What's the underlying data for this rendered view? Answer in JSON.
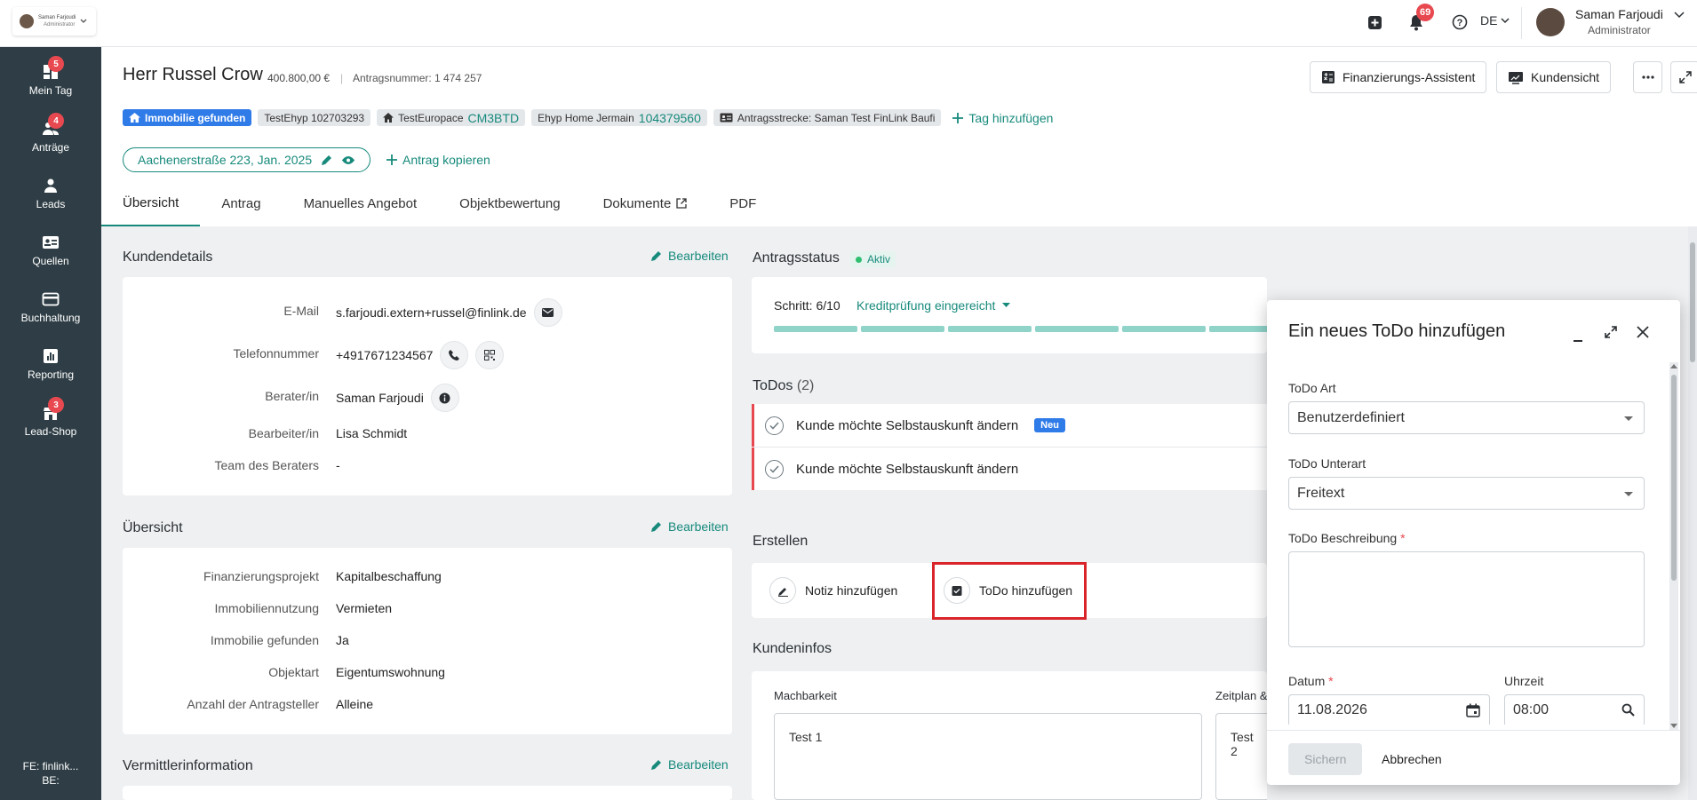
{
  "topbar": {
    "org_name": "Saman Farjoudi",
    "org_role": "Administrator",
    "notifications_count": "69",
    "language": "DE",
    "user_name": "Saman Farjoudi",
    "user_role": "Administrator"
  },
  "sidebar": {
    "items": [
      {
        "label": "Mein Tag",
        "badge": "5"
      },
      {
        "label": "Anträge",
        "badge": "4"
      },
      {
        "label": "Leads",
        "badge": ""
      },
      {
        "label": "Quellen",
        "badge": ""
      },
      {
        "label": "Buchhaltung",
        "badge": ""
      },
      {
        "label": "Reporting",
        "badge": ""
      },
      {
        "label": "Lead-Shop",
        "badge": "3"
      }
    ],
    "footer_fe": "FE: finlink...",
    "footer_be": "BE:"
  },
  "header": {
    "customer_name": "Herr Russel Crow",
    "amount": "400.800,00 €",
    "separator": "|",
    "application_number": "Antragsnummer: 1 474 257",
    "btn_assistant": "Finanzierungs-Assistent",
    "btn_customer_view": "Kundensicht",
    "tags": {
      "property_found": "Immobilie gefunden",
      "testehyp": "TestEhyp 102703293",
      "testeuropace_label": "TestEuropace",
      "testeuropace_value": "CM3BTD",
      "ehyp_label": "Ehyp Home Jermain",
      "ehyp_value": "104379560",
      "route": "Antragsstrecke: Saman Test FinLink Baufi",
      "add_tag": "Tag hinzufügen"
    },
    "address": "Aachenerstraße 223, Jan. 2025",
    "copy_application": "Antrag kopieren",
    "tabs": [
      "Übersicht",
      "Antrag",
      "Manuelles Angebot",
      "Objektbewertung",
      "Dokumente",
      "PDF"
    ]
  },
  "kundendetails": {
    "title": "Kundendetails",
    "edit": "Bearbeiten",
    "rows": [
      {
        "label": "E-Mail",
        "value": "s.farjoudi.extern+russel@finlink.de"
      },
      {
        "label": "Telefonnummer",
        "value": "+4917671234567"
      },
      {
        "label": "Berater/in",
        "value": "Saman Farjoudi"
      },
      {
        "label": "Bearbeiter/in",
        "value": "Lisa Schmidt"
      },
      {
        "label": "Team des Beraters",
        "value": "-"
      }
    ]
  },
  "uebersicht": {
    "title": "Übersicht",
    "edit": "Bearbeiten",
    "rows": [
      {
        "label": "Finanzierungsprojekt",
        "value": "Kapitalbeschaffung"
      },
      {
        "label": "Immobiliennutzung",
        "value": "Vermieten"
      },
      {
        "label": "Immobilie gefunden",
        "value": "Ja"
      },
      {
        "label": "Objektart",
        "value": "Eigentumswohnung"
      },
      {
        "label": "Anzahl der Antragsteller",
        "value": "Alleine"
      }
    ]
  },
  "vermittler": {
    "title": "Vermittlerinformation",
    "edit": "Bearbeiten"
  },
  "status": {
    "title": "Antragsstatus",
    "state": "Aktiv",
    "step": "Schritt: 6/10",
    "step_name": "Kreditprüfung eingereicht",
    "progress_done": 6,
    "progress_total": 10
  },
  "todos": {
    "title": "ToDos",
    "count": "(2)",
    "items": [
      {
        "text": "Kunde möchte Selbstauskunft ändern",
        "badge": "Neu"
      },
      {
        "text": "Kunde möchte Selbstauskunft ändern",
        "badge": ""
      }
    ]
  },
  "erstellen": {
    "title": "Erstellen",
    "note": "Notiz hinzufügen",
    "todo": "ToDo hinzufügen"
  },
  "kundeninfos": {
    "title": "Kundeninfos",
    "col1_label": "Machbarkeit",
    "col1_value": "Test 1",
    "col2_label": "Zeitplan &",
    "col2_value": "Test 2"
  },
  "modal": {
    "title": "Ein neues ToDo hinzufügen",
    "art_label": "ToDo Art",
    "art_value": "Benutzerdefiniert",
    "unterart_label": "ToDo Unterart",
    "unterart_value": "Freitext",
    "desc_label": "ToDo Beschreibung",
    "required_mark": "*",
    "date_label": "Datum",
    "date_value": "11.08.2026",
    "time_label": "Uhrzeit",
    "time_value": "08:00",
    "save": "Sichern",
    "cancel": "Abbrechen"
  },
  "colors": {
    "accent": "#178a7c",
    "sidebar": "#2f3e46",
    "badge": "#e8484f",
    "tag_blue": "#2f7be8",
    "highlight": "#d9252a"
  }
}
